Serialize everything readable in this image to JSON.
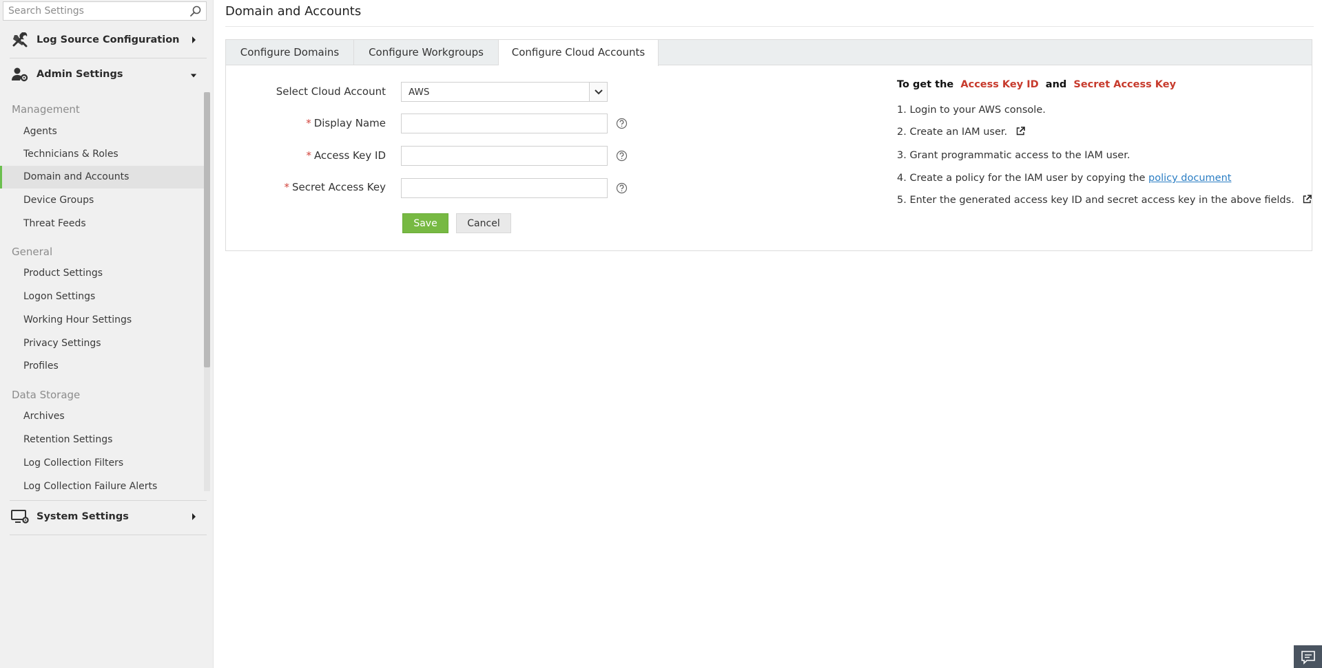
{
  "search": {
    "placeholder": "Search Settings"
  },
  "sidebar": {
    "sections": {
      "log_source": {
        "label": "Log Source Configuration"
      },
      "admin": {
        "label": "Admin Settings"
      },
      "system": {
        "label": "System Settings"
      }
    },
    "groups": {
      "management": {
        "label": "Management",
        "items": [
          "Agents",
          "Technicians & Roles",
          "Domain and Accounts",
          "Device Groups",
          "Threat Feeds"
        ]
      },
      "general": {
        "label": "General",
        "items": [
          "Product Settings",
          "Logon Settings",
          "Working Hour Settings",
          "Privacy Settings",
          "Profiles"
        ]
      },
      "data_storage": {
        "label": "Data Storage",
        "items": [
          "Archives",
          "Retention Settings",
          "Log Collection Filters",
          "Log Collection Failure Alerts"
        ]
      }
    },
    "active_item": "Domain and Accounts"
  },
  "page": {
    "title": "Domain and Accounts"
  },
  "tabs": {
    "items": [
      "Configure Domains",
      "Configure Workgroups",
      "Configure Cloud Accounts"
    ],
    "active": "Configure Cloud Accounts"
  },
  "form": {
    "cloud_account_label": "Select Cloud Account",
    "cloud_account_value": "AWS",
    "display_name_label": "Display Name",
    "access_key_label": "Access Key ID",
    "secret_key_label": "Secret Access Key",
    "required_mark": "*",
    "save_label": "Save",
    "cancel_label": "Cancel"
  },
  "info": {
    "title_prefix": "To get the",
    "title_key1": "Access Key ID",
    "title_and": "and",
    "title_key2": "Secret Access Key",
    "step1": "1. Login to your AWS console.",
    "step2": "2. Create an IAM user.",
    "step3": "3. Grant programmatic access to the IAM user.",
    "step4_text": "4. Create a policy for the IAM user by copying the",
    "step4_link": "policy document",
    "step5": "5. Enter the generated access key ID and secret access key in the above fields."
  },
  "colors": {
    "accent_green": "#77b943",
    "highlight_red": "#c73a2c",
    "link_blue": "#2b7ec4",
    "sidebar_bg": "#f0f0f0"
  },
  "icons": {
    "search": "search-icon",
    "log_source": "tools-icon",
    "admin": "user-gear-icon",
    "system": "monitor-gear-icon",
    "help": "help-icon",
    "external": "external-link-icon",
    "chat": "chat-icon"
  }
}
